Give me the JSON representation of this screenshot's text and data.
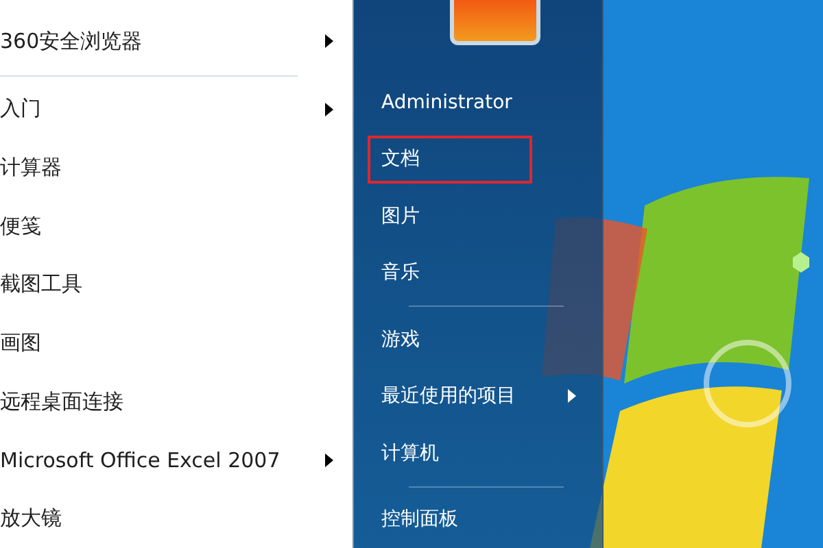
{
  "left_panel": {
    "pinned": [
      {
        "label": "360安全浏览器",
        "has_submenu": true
      }
    ],
    "recent": [
      {
        "label": "入门",
        "has_submenu": true
      },
      {
        "label": "计算器",
        "has_submenu": false
      },
      {
        "label": "便笺",
        "has_submenu": false
      },
      {
        "label": "截图工具",
        "has_submenu": false
      },
      {
        "label": "画图",
        "has_submenu": false
      },
      {
        "label": "远程桌面连接",
        "has_submenu": false
      },
      {
        "label": "Microsoft Office Excel 2007",
        "has_submenu": true
      },
      {
        "label": "放大镜",
        "has_submenu": false
      }
    ]
  },
  "right_panel": {
    "groups": [
      [
        {
          "label": "Administrator",
          "has_submenu": false,
          "highlighted": false
        },
        {
          "label": "文档",
          "has_submenu": false,
          "highlighted": true
        },
        {
          "label": "图片",
          "has_submenu": false,
          "highlighted": false
        },
        {
          "label": "音乐",
          "has_submenu": false,
          "highlighted": false
        }
      ],
      [
        {
          "label": "游戏",
          "has_submenu": false,
          "highlighted": false
        },
        {
          "label": "最近使用的项目",
          "has_submenu": true,
          "highlighted": false
        },
        {
          "label": "计算机",
          "has_submenu": false,
          "highlighted": false
        }
      ],
      [
        {
          "label": "控制面板",
          "has_submenu": false,
          "highlighted": false
        }
      ]
    ]
  }
}
